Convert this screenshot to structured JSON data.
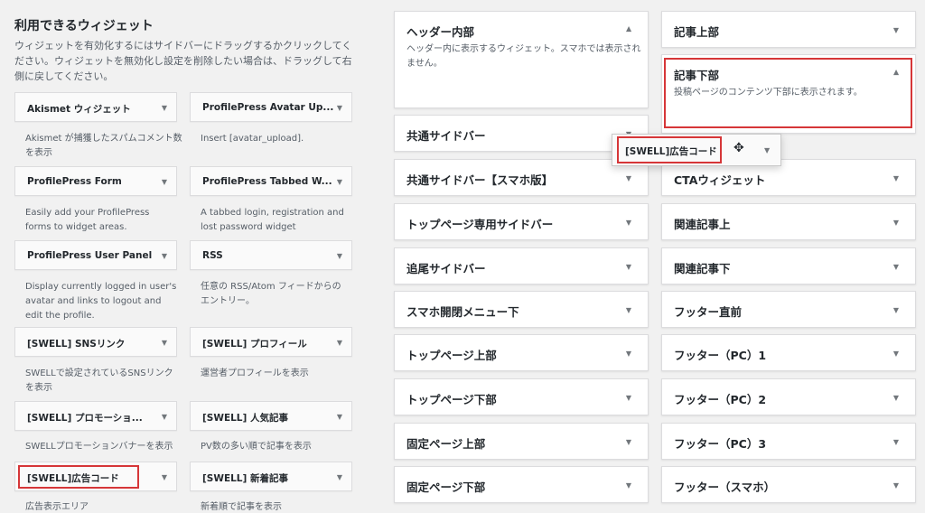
{
  "available": {
    "title": "利用できるウィジェット",
    "description": "ウィジェットを有効化するにはサイドバーにドラッグするかクリックしてください。ウィジェットを無効化し設定を削除したい場合は、ドラッグして右側に戻してください。",
    "widgets": [
      {
        "title": "Akismet ウィジェット",
        "desc": "Akismet が捕獲したスパムコメント数を表示"
      },
      {
        "title": "ProfilePress Avatar Up...",
        "desc": "Insert [avatar_upload]."
      },
      {
        "title": "ProfilePress Form",
        "desc": "Easily add your ProfilePress forms to widget areas."
      },
      {
        "title": "ProfilePress Tabbed W...",
        "desc": "A tabbed login, registration and lost password widget"
      },
      {
        "title": "ProfilePress User Panel",
        "desc": "Display currently logged in user's avatar and links to logout and edit the profile."
      },
      {
        "title": "RSS",
        "desc": "任意の RSS/Atom フィードからのエントリー。"
      },
      {
        "title": "[SWELL] SNSリンク",
        "desc": "SWELLで設定されているSNSリンクを表示"
      },
      {
        "title": "[SWELL] プロフィール",
        "desc": "運営者プロフィールを表示"
      },
      {
        "title": "[SWELL] プロモーショ...",
        "desc": "SWELLプロモーションバナーを表示"
      },
      {
        "title": "[SWELL] 人気記事",
        "desc": "PV数の多い順で記事を表示"
      },
      {
        "title": "[SWELL]広告コード",
        "desc": "広告表示エリア"
      },
      {
        "title": "[SWELL] 新着記事",
        "desc": "新着順で記事を表示"
      }
    ]
  },
  "areas_middle": [
    {
      "title": "ヘッダー内部",
      "desc": "ヘッダー内に表示するウィジェット。スマホでは表示されません。"
    },
    {
      "title": "共通サイドバー"
    },
    {
      "title": "共通サイドバー【スマホ版】"
    },
    {
      "title": "トップページ専用サイドバー"
    },
    {
      "title": "追尾サイドバー"
    },
    {
      "title": "スマホ開閉メニュー下"
    },
    {
      "title": "トップページ上部"
    },
    {
      "title": "トップページ下部"
    },
    {
      "title": "固定ページ上部"
    },
    {
      "title": "固定ページ下部"
    }
  ],
  "areas_right": [
    {
      "title": "記事上部"
    },
    {
      "title": "記事下部",
      "desc": "投稿ページのコンテンツ下部に表示されます。"
    },
    {
      "title": "CTAウィジェット"
    },
    {
      "title": "関連記事上"
    },
    {
      "title": "関連記事下"
    },
    {
      "title": "フッター直前"
    },
    {
      "title": "フッター（PC）1"
    },
    {
      "title": "フッター（PC）2"
    },
    {
      "title": "フッター（PC）3"
    },
    {
      "title": "フッター（スマホ）"
    }
  ],
  "dragging": {
    "title": "[SWELL]広告コード"
  },
  "icons": {
    "caret": "▼",
    "move": "✥"
  },
  "colors": {
    "highlight": "#d63638",
    "background": "#f1f1f1"
  }
}
